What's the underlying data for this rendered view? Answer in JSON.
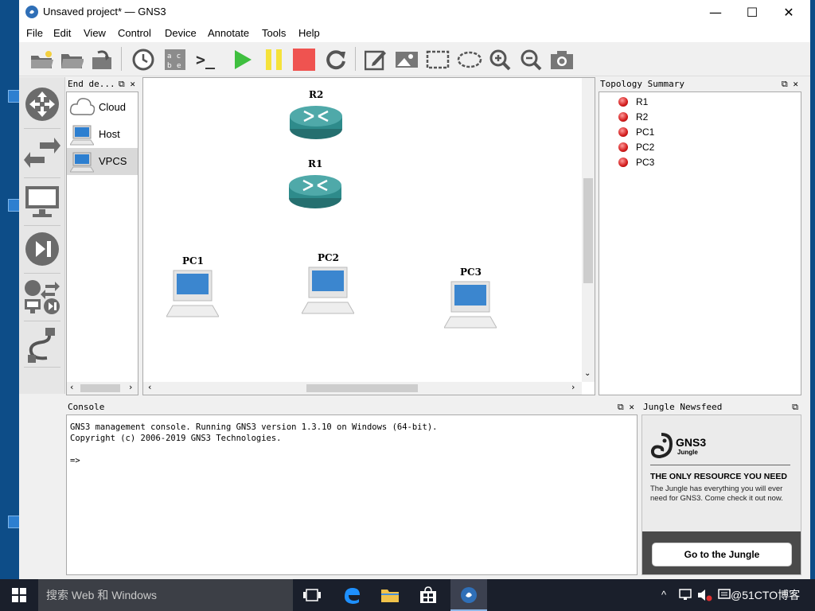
{
  "window": {
    "title": "Unsaved project* — GNS3",
    "controls": {
      "minimize": "—",
      "maximize": "☐",
      "close": "✕"
    }
  },
  "menu": [
    "File",
    "Edit",
    "View",
    "Control",
    "Device",
    "Annotate",
    "Tools",
    "Help"
  ],
  "toolbar": {
    "icons": [
      "new-project-icon",
      "open-project-icon",
      "save-project-icon",
      "snapshot-clock-icon",
      "show-interface-labels-icon",
      "console-all-icon",
      "start-all-icon",
      "suspend-all-icon",
      "stop-all-icon",
      "reload-all-icon",
      "add-note-icon",
      "insert-picture-icon",
      "draw-rectangle-icon",
      "draw-ellipse-icon",
      "zoom-in-icon",
      "zoom-out-icon",
      "screenshot-icon"
    ],
    "console_glyph": ">_"
  },
  "device_types": [
    "routers-icon",
    "switches-icon",
    "end-devices-icon",
    "security-devices-icon",
    "all-devices-icon",
    "add-link-icon"
  ],
  "end_devices": {
    "title": "End de...",
    "items": [
      {
        "label": "Cloud"
      },
      {
        "label": "Host"
      },
      {
        "label": "VPCS"
      }
    ]
  },
  "canvas": {
    "nodes": [
      {
        "label": "R2",
        "kind": "router"
      },
      {
        "label": "R1",
        "kind": "router"
      },
      {
        "label": "PC1",
        "kind": "pc"
      },
      {
        "label": "PC2",
        "kind": "pc"
      },
      {
        "label": "PC3",
        "kind": "pc"
      }
    ]
  },
  "topology": {
    "title": "Topology Summary",
    "items": [
      "R1",
      "R2",
      "PC1",
      "PC2",
      "PC3"
    ],
    "status_color": "#d21b1b"
  },
  "console": {
    "title": "Console",
    "lines": [
      "GNS3 management console. Running GNS3 version 1.3.10 on Windows (64-bit).",
      "Copyright (c) 2006-2019 GNS3 Technologies.",
      "",
      "=>"
    ]
  },
  "newsfeed": {
    "title": "Jungle Newsfeed",
    "logo_text": "GNS3",
    "logo_sub": "Jungle",
    "headline": "THE ONLY RESOURCE YOU NEED",
    "body": "The Jungle has everything you will ever need for GNS3. Come check it out now.",
    "button": "Go to the Jungle"
  },
  "taskbar": {
    "search_placeholder": "搜索 Web 和 Windows",
    "tray_text": "@51CTO博客",
    "tray_caret": "^"
  },
  "colors": {
    "start": "#3fbf3f",
    "suspend": "#f5e23a",
    "stop": "#ef5350",
    "router": "#2e8b8b"
  }
}
